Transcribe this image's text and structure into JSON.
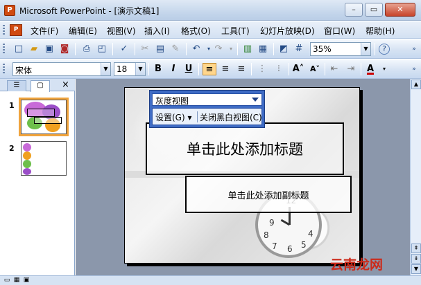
{
  "window": {
    "title": "Microsoft PowerPoint - [演示文稿1]",
    "min_label": "–",
    "restore_label": "▭",
    "close_label": "✕"
  },
  "menu": {
    "doc_icon": "P",
    "items": [
      "文件(F)",
      "编辑(E)",
      "视图(V)",
      "插入(I)",
      "格式(O)",
      "工具(T)",
      "幻灯片放映(D)",
      "窗口(W)",
      "帮助(H)"
    ]
  },
  "standard_toolbar": {
    "zoom": "35%",
    "help_icon": "?"
  },
  "formatting_toolbar": {
    "font_name": "宋体",
    "font_size": "18",
    "bold": "B",
    "italic": "I",
    "underline": "U"
  },
  "slide_panel": {
    "tab_outline": "☰",
    "tab_slides": "▢",
    "close": "×",
    "slides": [
      {
        "number": "1",
        "selected": true
      },
      {
        "number": "2",
        "selected": false
      }
    ]
  },
  "slide": {
    "title_placeholder": "单击此处添加标题",
    "subtitle_placeholder": "单击此处添加副标题"
  },
  "grayscale_toolbar": {
    "title": "灰度视图",
    "settings": "设置(G) ▾",
    "close_grayscale": "关闭黑白视图(C)"
  },
  "watermark": "云南龙网",
  "colors": {
    "selection_outline": "#f0a33c",
    "toolbar_blue": "#3e6bc4"
  }
}
